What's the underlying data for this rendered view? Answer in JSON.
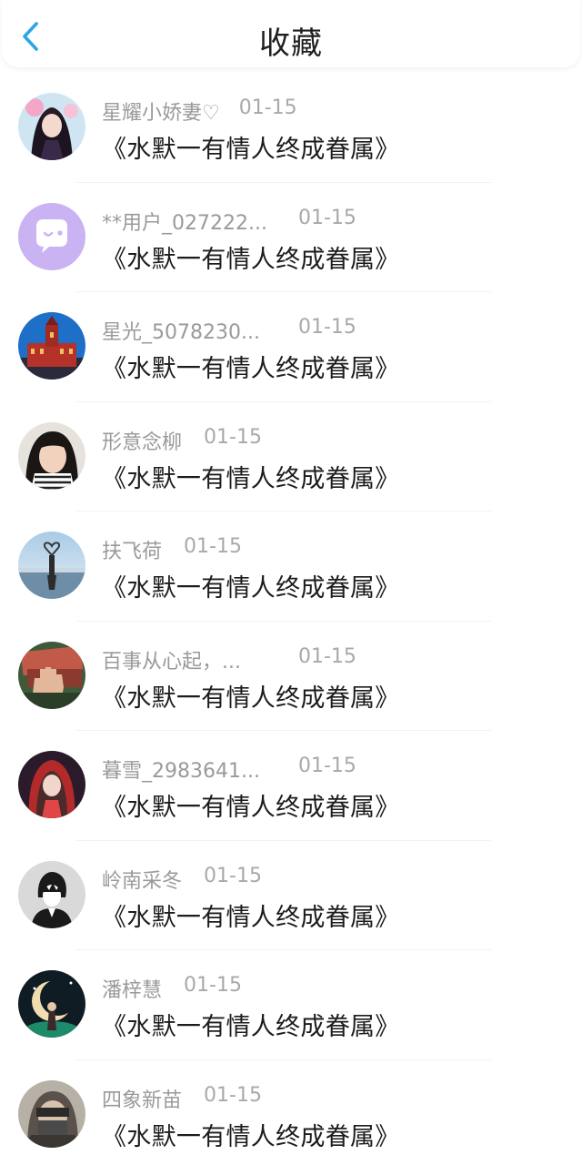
{
  "header": {
    "title": "收藏",
    "back_icon": "chevron-left-icon",
    "accent_color": "#2ba6e6"
  },
  "items": [
    {
      "username": "星耀小娇妻♡",
      "date": "01-15",
      "title": "《水默一有情人终成眷属》",
      "avatar": "girl-doll-avatar"
    },
    {
      "username": "**用户_027222...",
      "date": "01-15",
      "title": "《水默一有情人终成眷属》",
      "avatar": "chat-bubble-default-avatar"
    },
    {
      "username": "星光_5078230...",
      "date": "01-15",
      "title": "《水默一有情人终成眷属》",
      "avatar": "red-building-avatar"
    },
    {
      "username": "形意念柳",
      "date": "01-15",
      "title": "《水默一有情人终成眷属》",
      "avatar": "child-photo-avatar"
    },
    {
      "username": "扶飞荷",
      "date": "01-15",
      "title": "《水默一有情人终成眷属》",
      "avatar": "seaside-heart-avatar"
    },
    {
      "username": "百事从心起，...",
      "date": "01-15",
      "title": "《水默一有情人终成眷属》",
      "avatar": "hand-money-avatar"
    },
    {
      "username": "暮雪_2983641...",
      "date": "01-15",
      "title": "《水默一有情人终成眷属》",
      "avatar": "red-hood-girl-avatar"
    },
    {
      "username": "岭南采冬",
      "date": "01-15",
      "title": "《水默一有情人终成眷属》",
      "avatar": "anime-boy-avatar"
    },
    {
      "username": "潘梓慧",
      "date": "01-15",
      "title": "《水默一有情人终成眷属》",
      "avatar": "moon-fantasy-avatar"
    },
    {
      "username": "四象新苗",
      "date": "01-15",
      "title": "《水默一有情人终成眷属》",
      "avatar": "masked-person-avatar"
    }
  ]
}
